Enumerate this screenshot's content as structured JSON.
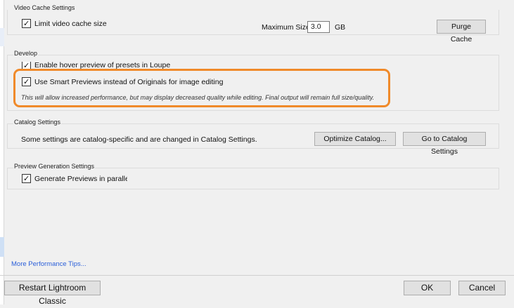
{
  "video_cache": {
    "title": "Video Cache Settings",
    "limit_label": "Limit video cache size",
    "limit_checked": true,
    "max_size_label": "Maximum Size:",
    "max_size_value": "3.0",
    "unit": "GB",
    "purge_button": "Purge Cache"
  },
  "develop": {
    "title": "Develop",
    "hover_preview_label": "Enable hover preview of presets in Loupe",
    "hover_preview_checked": true,
    "smart_previews_label": "Use Smart Previews instead of Originals for image editing",
    "smart_previews_checked": true,
    "smart_previews_note": "This will allow increased performance, but may display decreased quality while editing. Final output will remain full size/quality."
  },
  "catalog": {
    "title": "Catalog Settings",
    "description": "Some settings are catalog-specific and are changed in Catalog Settings.",
    "optimize_button": "Optimize Catalog...",
    "goto_button": "Go to Catalog Settings"
  },
  "preview_generation": {
    "title": "Preview Generation Settings",
    "parallel_label": "Generate Previews in parallel",
    "parallel_checked": true
  },
  "footer": {
    "tips_link": "More Performance Tips...",
    "restart_button": "Restart Lightroom Classic",
    "ok_button": "OK",
    "cancel_button": "Cancel"
  },
  "colors": {
    "highlight_outline": "#f08a2a",
    "link": "#2b5fd9"
  },
  "icons": {
    "checkbox_mark": "checkmark-icon"
  }
}
